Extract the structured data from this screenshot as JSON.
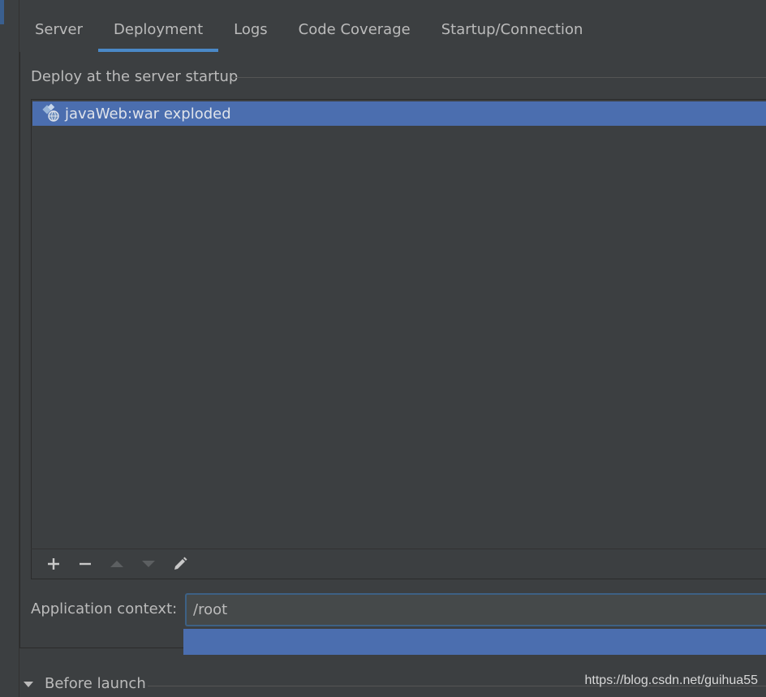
{
  "tabs": [
    {
      "label": "Server"
    },
    {
      "label": "Deployment"
    },
    {
      "label": "Logs"
    },
    {
      "label": "Code Coverage"
    },
    {
      "label": "Startup/Connection"
    }
  ],
  "active_tab": "Deployment",
  "deploy_group": {
    "title": "Deploy at the server startup",
    "items": [
      {
        "label": "javaWeb:war exploded",
        "icon": "artifact-web-icon",
        "selected": true
      }
    ]
  },
  "toolbar": {
    "add_icon": "plus-icon",
    "remove_icon": "minus-icon",
    "up_icon": "arrow-up-icon",
    "down_icon": "arrow-down-icon",
    "edit_icon": "pencil-icon"
  },
  "application_context": {
    "label": "Application context:",
    "value": "/root"
  },
  "before_launch": {
    "label": "Before launch"
  },
  "watermark": "https://blog.csdn.net/guihua55",
  "colors": {
    "background": "#3c3f41",
    "selection": "#4b6eaf",
    "tab_underline": "#4a88c7",
    "text": "#bbbbbb"
  }
}
